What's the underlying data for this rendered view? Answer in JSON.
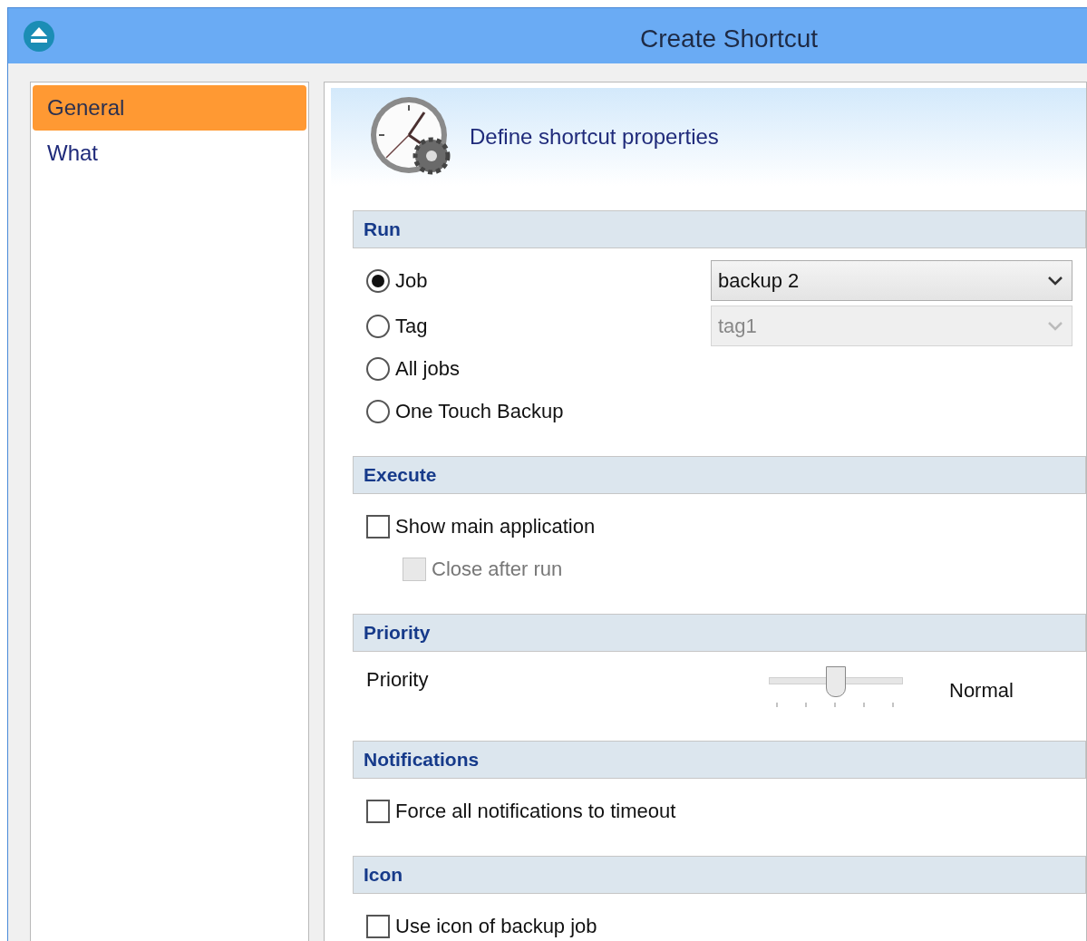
{
  "window": {
    "title": "Create Shortcut"
  },
  "sidebar": {
    "items": [
      {
        "label": "General",
        "selected": true
      },
      {
        "label": "What",
        "selected": false
      }
    ]
  },
  "header": {
    "text": "Define shortcut properties"
  },
  "sections": [
    {
      "title": "Run",
      "rows": [
        {
          "kind": "radio",
          "label": "Job",
          "selected": true,
          "dropdown": {
            "value": "backup 2",
            "disabled": false
          }
        },
        {
          "kind": "radio",
          "label": "Tag",
          "selected": false,
          "dropdown": {
            "value": "tag1",
            "disabled": true
          }
        },
        {
          "kind": "radio",
          "label": "All jobs",
          "selected": false
        },
        {
          "kind": "radio",
          "label": "One Touch Backup",
          "selected": false
        }
      ]
    },
    {
      "title": "Execute",
      "rows": [
        {
          "kind": "checkbox",
          "label": "Show main application",
          "checked": false,
          "disabled": false,
          "indented": false
        },
        {
          "kind": "checkbox",
          "label": "Close after run",
          "checked": false,
          "disabled": true,
          "indented": true
        }
      ]
    },
    {
      "title": "Priority",
      "rows": [
        {
          "kind": "slider",
          "label": "Priority",
          "level": 0.5,
          "reading": "Normal"
        }
      ]
    },
    {
      "title": "Notifications",
      "rows": [
        {
          "kind": "checkbox",
          "label": "Force all notifications to timeout",
          "checked": false,
          "disabled": false,
          "indented": false
        }
      ]
    },
    {
      "title": "Icon",
      "rows": [
        {
          "kind": "checkbox",
          "label": "Use icon of backup job",
          "checked": false,
          "disabled": false,
          "indented": false
        }
      ]
    }
  ]
}
